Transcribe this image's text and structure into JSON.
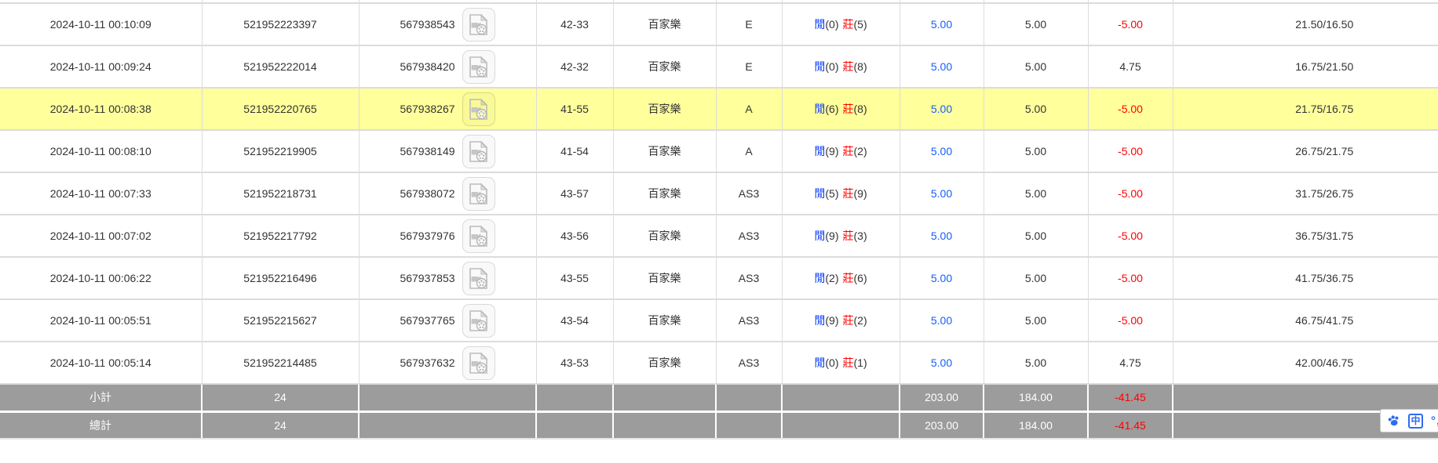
{
  "labels": {
    "player": "閒",
    "banker": "莊"
  },
  "table": {
    "rows": [
      {
        "time": "2024-10-11 00:10:09",
        "bet_id": "521952223397",
        "game_id": "567938543",
        "round": "42-33",
        "game": "百家樂",
        "table_code": "E",
        "player_score": "(0)",
        "banker_score": "(5)",
        "bet": "5.00",
        "valid": "5.00",
        "winloss": "-5.00",
        "balance": "21.50/16.50",
        "highlighted": false
      },
      {
        "time": "2024-10-11 00:09:24",
        "bet_id": "521952222014",
        "game_id": "567938420",
        "round": "42-32",
        "game": "百家樂",
        "table_code": "E",
        "player_score": "(0)",
        "banker_score": "(8)",
        "bet": "5.00",
        "valid": "5.00",
        "winloss": "4.75",
        "balance": "16.75/21.50",
        "highlighted": false
      },
      {
        "time": "2024-10-11 00:08:38",
        "bet_id": "521952220765",
        "game_id": "567938267",
        "round": "41-55",
        "game": "百家樂",
        "table_code": "A",
        "player_score": "(6)",
        "banker_score": "(8)",
        "bet": "5.00",
        "valid": "5.00",
        "winloss": "-5.00",
        "balance": "21.75/16.75",
        "highlighted": true
      },
      {
        "time": "2024-10-11 00:08:10",
        "bet_id": "521952219905",
        "game_id": "567938149",
        "round": "41-54",
        "game": "百家樂",
        "table_code": "A",
        "player_score": "(9)",
        "banker_score": "(2)",
        "bet": "5.00",
        "valid": "5.00",
        "winloss": "-5.00",
        "balance": "26.75/21.75",
        "highlighted": false
      },
      {
        "time": "2024-10-11 00:07:33",
        "bet_id": "521952218731",
        "game_id": "567938072",
        "round": "43-57",
        "game": "百家樂",
        "table_code": "AS3",
        "player_score": "(5)",
        "banker_score": "(9)",
        "bet": "5.00",
        "valid": "5.00",
        "winloss": "-5.00",
        "balance": "31.75/26.75",
        "highlighted": false
      },
      {
        "time": "2024-10-11 00:07:02",
        "bet_id": "521952217792",
        "game_id": "567937976",
        "round": "43-56",
        "game": "百家樂",
        "table_code": "AS3",
        "player_score": "(9)",
        "banker_score": "(3)",
        "bet": "5.00",
        "valid": "5.00",
        "winloss": "-5.00",
        "balance": "36.75/31.75",
        "highlighted": false
      },
      {
        "time": "2024-10-11 00:06:22",
        "bet_id": "521952216496",
        "game_id": "567937853",
        "round": "43-55",
        "game": "百家樂",
        "table_code": "AS3",
        "player_score": "(2)",
        "banker_score": "(6)",
        "bet": "5.00",
        "valid": "5.00",
        "winloss": "-5.00",
        "balance": "41.75/36.75",
        "highlighted": false
      },
      {
        "time": "2024-10-11 00:05:51",
        "bet_id": "521952215627",
        "game_id": "567937765",
        "round": "43-54",
        "game": "百家樂",
        "table_code": "AS3",
        "player_score": "(9)",
        "banker_score": "(2)",
        "bet": "5.00",
        "valid": "5.00",
        "winloss": "-5.00",
        "balance": "46.75/41.75",
        "highlighted": false
      },
      {
        "time": "2024-10-11 00:05:14",
        "bet_id": "521952214485",
        "game_id": "567937632",
        "round": "43-53",
        "game": "百家樂",
        "table_code": "AS3",
        "player_score": "(0)",
        "banker_score": "(1)",
        "bet": "5.00",
        "valid": "5.00",
        "winloss": "4.75",
        "balance": "42.00/46.75",
        "highlighted": false
      }
    ],
    "subtotal": {
      "label": "小計",
      "count": "24",
      "bet": "203.00",
      "valid": "184.00",
      "winloss": "-41.45"
    },
    "total": {
      "label": "總計",
      "count": "24",
      "bet": "203.00",
      "valid": "184.00",
      "winloss": "-41.45"
    }
  },
  "widget": {
    "lang": "中",
    "partial_glyph": "°,"
  },
  "colors": {
    "highlight_row": "#ffff9c",
    "summary_bg": "#9c9c9c",
    "loss_red": "#ff0000",
    "bet_link_blue": "#155eff",
    "player_blue": "#0a3cff",
    "banker_red": "#ff0000",
    "widget_blue": "#2e6cf0",
    "grid_line": "#dcdcdc"
  }
}
